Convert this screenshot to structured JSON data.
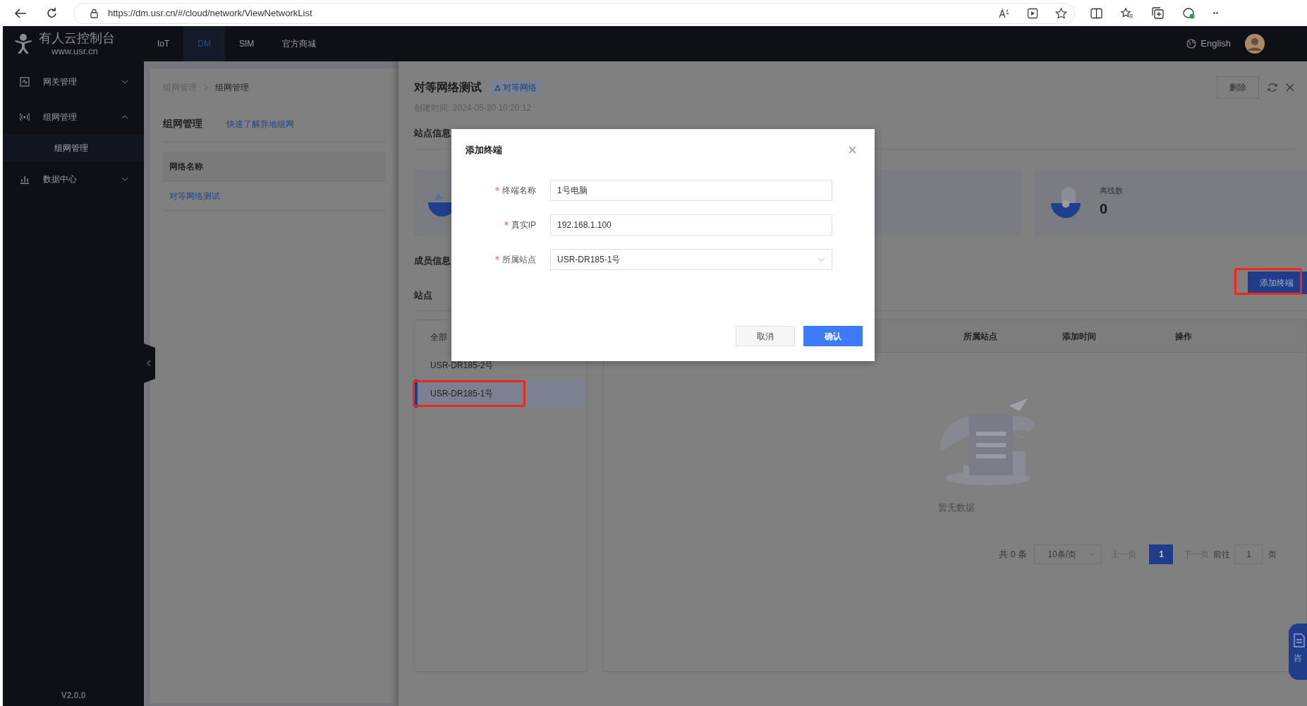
{
  "browser": {
    "url": "https://dm.usr.cn/#/cloud/network/ViewNetworkList"
  },
  "header": {
    "logo_title": "有人云控制台",
    "logo_subtitle": "www.usr.cn",
    "nav": [
      {
        "label": "IoT",
        "selected": false
      },
      {
        "label": "DM",
        "selected": true
      },
      {
        "label": "SIM",
        "selected": false
      },
      {
        "label": "官方商城",
        "selected": false
      }
    ],
    "language": "English"
  },
  "sidebar": {
    "items": [
      {
        "label": "网关管理",
        "expanded": false
      },
      {
        "label": "组网管理",
        "expanded": true,
        "children": [
          {
            "label": "组网管理",
            "selected": true
          }
        ]
      },
      {
        "label": "数据中心",
        "expanded": false
      }
    ],
    "version": "V2.0.0"
  },
  "page": {
    "breadcrumb": [
      "组网管理",
      "组网管理"
    ],
    "title": "组网管理",
    "help_link": "快速了解异地组网",
    "table": {
      "columns": [
        "网络名称"
      ],
      "rows": [
        [
          "对等网络测试"
        ]
      ]
    }
  },
  "drawer": {
    "title": "对等网络测试",
    "tag": "对等网络",
    "created": "创建时间: 2024-05-30 10:20:12",
    "delete_button": "删除",
    "section_sites": "站点信息",
    "stat": {
      "label": "离线数",
      "value": "0"
    },
    "section_members": "成员信息",
    "sites_heading": "站点",
    "add_button": {
      "label": "添加终端",
      "highlighted": true
    },
    "site_list": [
      {
        "label": "全部",
        "selected": false,
        "highlighted": false
      },
      {
        "label": "USR-DR185-2号",
        "selected": false,
        "highlighted": false
      },
      {
        "label": "USR-DR185-1号",
        "selected": true,
        "highlighted": true
      }
    ],
    "member_table": {
      "columns": [
        "所属站点",
        "添加时间",
        "操作"
      ]
    },
    "empty_text": "暂无数据",
    "pagination": {
      "total": "共 0 条",
      "page_size": "10条/页",
      "prev": "上一页",
      "pages": [
        {
          "label": "1",
          "selected": true
        }
      ],
      "next": "下一页",
      "goto_label": "前往",
      "goto_value": "1",
      "goto_suffix": "页"
    }
  },
  "consult_button": "咨",
  "dialog": {
    "title": "添加终端",
    "fields": [
      {
        "label": "终端名称",
        "required": true,
        "kind": "text",
        "value": "1号电脑"
      },
      {
        "label": "真实IP",
        "required": true,
        "kind": "text",
        "value": "192.168.1.100"
      },
      {
        "label": "所属站点",
        "required": true,
        "kind": "select",
        "value": "USR-DR185-1号"
      }
    ],
    "buttons": [
      {
        "label": "取消",
        "kind": "secondary"
      },
      {
        "label": "确认",
        "kind": "primary"
      }
    ]
  }
}
